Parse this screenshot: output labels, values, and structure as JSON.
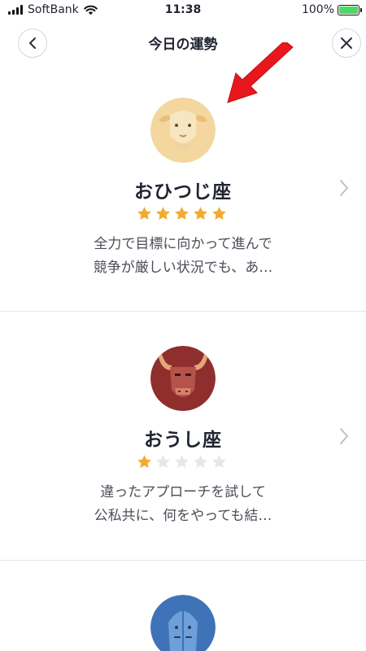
{
  "status_bar": {
    "carrier": "SoftBank",
    "time": "11:38",
    "battery": "100%"
  },
  "nav": {
    "title": "今日の運勢"
  },
  "cards": [
    {
      "name": "おひつじ座",
      "rating": 5,
      "max": 5,
      "desc_line1": "全力で目標に向かって進んで",
      "desc_line2": "競争が厳しい状況でも、あ…"
    },
    {
      "name": "おうし座",
      "rating": 1,
      "max": 5,
      "desc_line1": "違ったアプローチを試して",
      "desc_line2": "公私共に、何をやっても結…"
    }
  ],
  "colors": {
    "star_on": "#f2ab2f",
    "star_off": "#e7e8e6",
    "aries_bg": "#f3d79f",
    "taurus_bg": "#8e2f2e",
    "gemini_bg": "#3e73b8",
    "arrow": "#e8171b"
  }
}
